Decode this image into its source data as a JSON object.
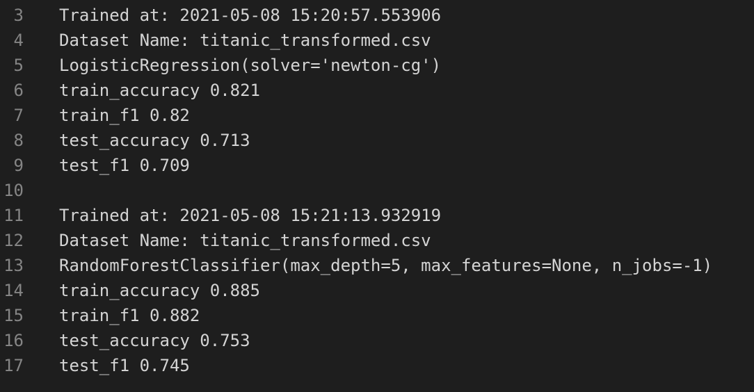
{
  "editor": {
    "lines": [
      {
        "num": "3",
        "text": "Trained at: 2021-05-08 15:20:57.553906"
      },
      {
        "num": "4",
        "text": "Dataset Name: titanic_transformed.csv"
      },
      {
        "num": "5",
        "text": "LogisticRegression(solver='newton-cg')"
      },
      {
        "num": "6",
        "text": "train_accuracy 0.821"
      },
      {
        "num": "7",
        "text": "train_f1 0.82"
      },
      {
        "num": "8",
        "text": "test_accuracy 0.713"
      },
      {
        "num": "9",
        "text": "test_f1 0.709"
      },
      {
        "num": "10",
        "text": ""
      },
      {
        "num": "11",
        "text": "Trained at: 2021-05-08 15:21:13.932919"
      },
      {
        "num": "12",
        "text": "Dataset Name: titanic_transformed.csv"
      },
      {
        "num": "13",
        "text": "RandomForestClassifier(max_depth=5, max_features=None, n_jobs=-1)"
      },
      {
        "num": "14",
        "text": "train_accuracy 0.885"
      },
      {
        "num": "15",
        "text": "train_f1 0.882"
      },
      {
        "num": "16",
        "text": "test_accuracy 0.753"
      },
      {
        "num": "17",
        "text": "test_f1 0.745"
      }
    ]
  }
}
